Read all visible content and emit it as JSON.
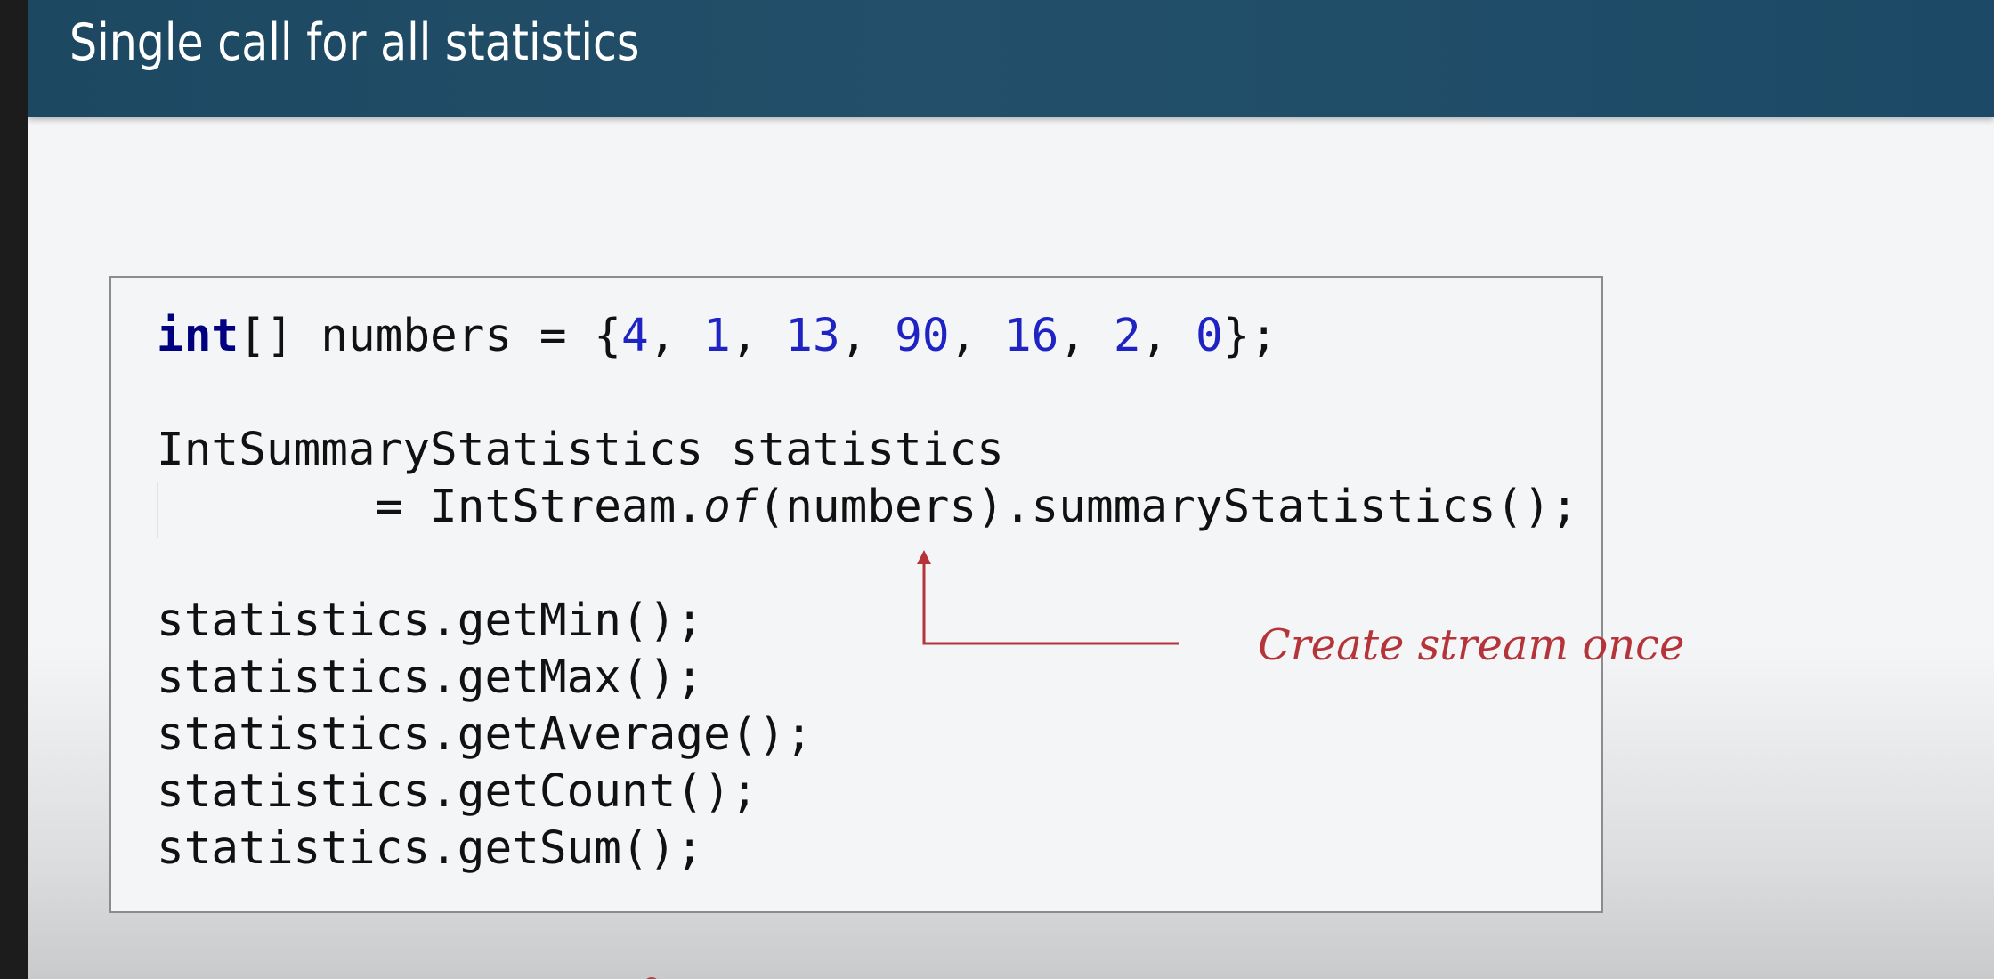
{
  "slide": {
    "title": "Single call for all statistics"
  },
  "code": {
    "line1": {
      "keyword": "int",
      "decl": "[] numbers = {",
      "values": [
        "4",
        "1",
        "13",
        "90",
        "16",
        "2",
        "0"
      ],
      "sep": ", ",
      "end": "};"
    },
    "line2": "IntSummaryStatistics statistics",
    "line3": {
      "prefix": "        = IntStream.",
      "method": "of",
      "suffix": "(numbers).summaryStatistics();"
    },
    "calls": [
      "statistics.getMin();",
      "statistics.getMax();",
      "statistics.getAverage();",
      "statistics.getCount();",
      "statistics.getSum();"
    ]
  },
  "annotation": {
    "text": "Create stream once",
    "color": "#b5343a"
  },
  "colors": {
    "header": "#1f4b65",
    "keyword": "#000080",
    "number": "#1f23c4",
    "text": "#111111"
  }
}
